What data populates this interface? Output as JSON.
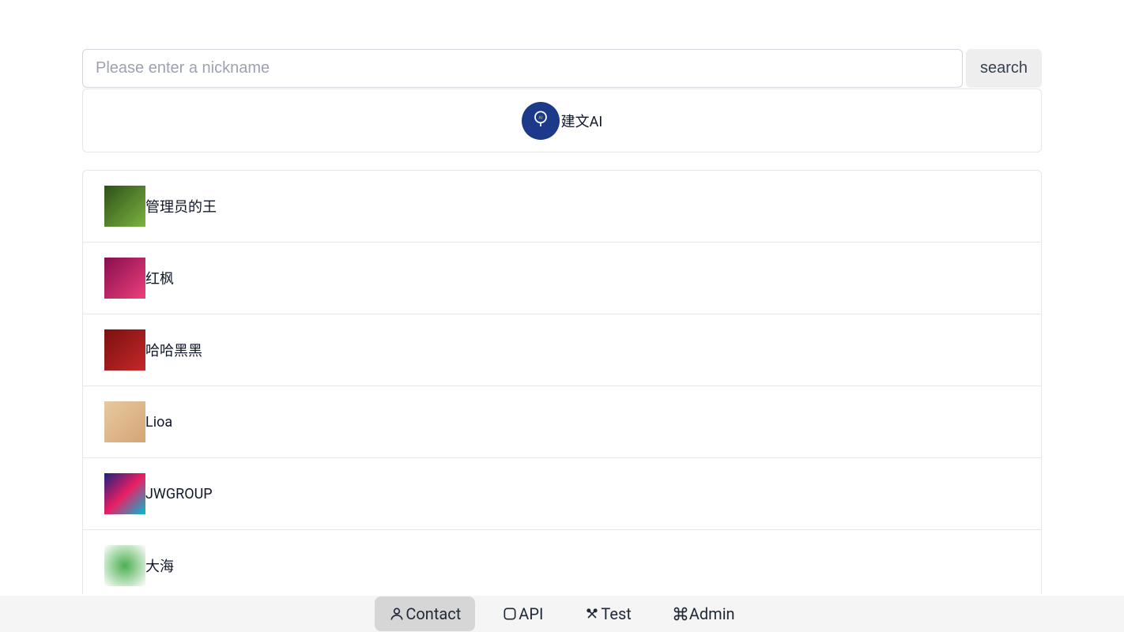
{
  "search": {
    "placeholder": "Please enter a nickname",
    "button_label": "search"
  },
  "ai_contact": {
    "name": "建文AI"
  },
  "contacts": [
    {
      "name": "管理员的王"
    },
    {
      "name": "红枫"
    },
    {
      "name": "哈哈黑黑"
    },
    {
      "name": "Lioa"
    },
    {
      "name": "JWGROUP"
    },
    {
      "name": "大海"
    }
  ],
  "nav": {
    "contact": "Contact",
    "api": "API",
    "test": "Test",
    "admin": "Admin"
  }
}
